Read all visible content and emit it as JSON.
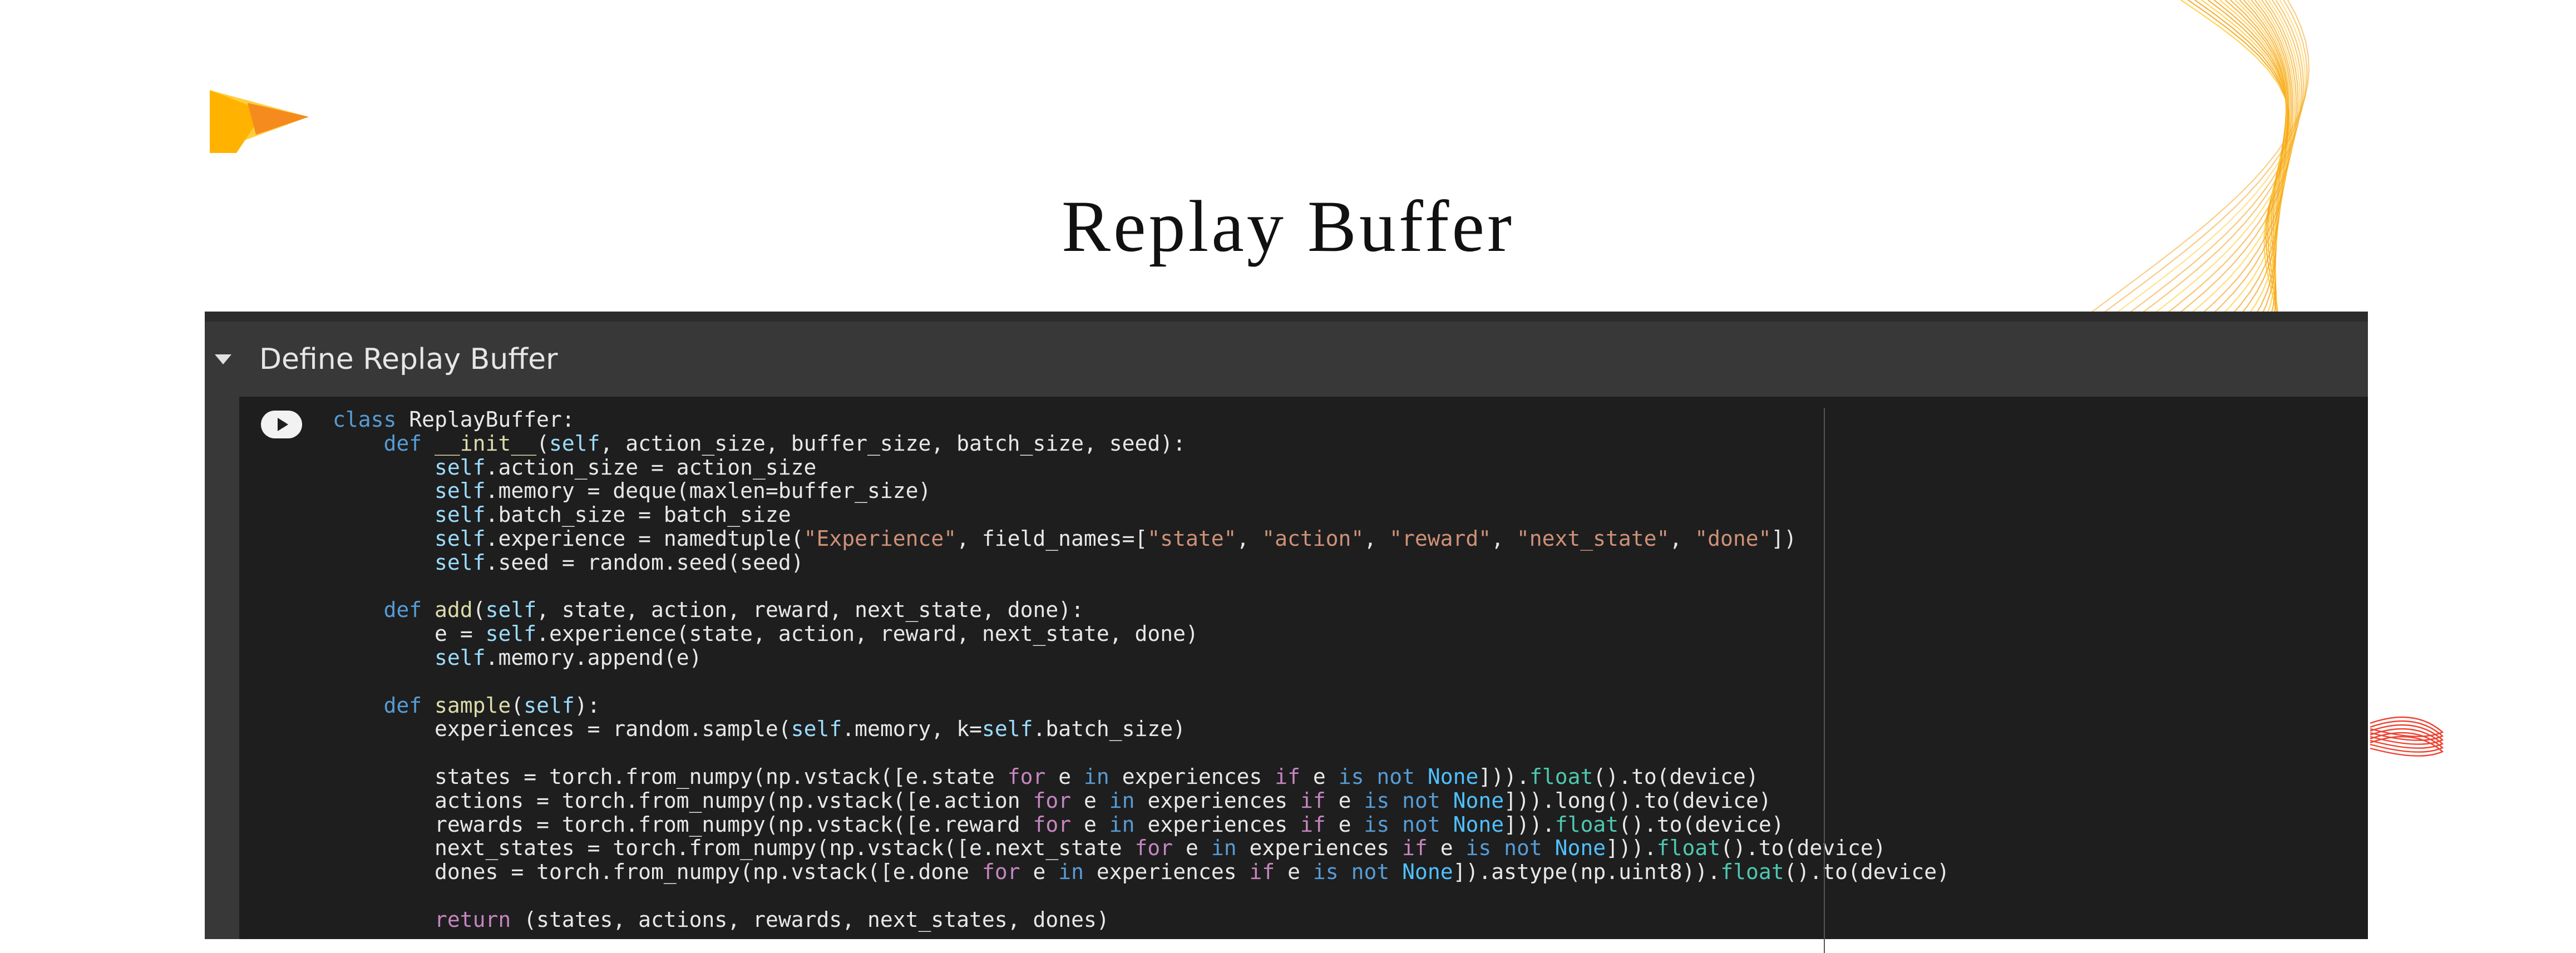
{
  "slide": {
    "title": "Replay Buffer"
  },
  "colors": {
    "accent_orange": "#f5a623",
    "accent_yellow": "#ffcf3a",
    "wave_red": "#ee4433"
  },
  "icons": [
    "play-logo-icon",
    "caret-down-icon",
    "run-cell-icon"
  ],
  "notebook": {
    "section_title": "Define Replay Buffer",
    "code_lines": [
      "class ReplayBuffer:",
      "    def __init__(self, action_size, buffer_size, batch_size, seed):",
      "        self.action_size = action_size",
      "        self.memory = deque(maxlen=buffer_size)",
      "        self.batch_size = batch_size",
      "        self.experience = namedtuple(\"Experience\", field_names=[\"state\", \"action\", \"reward\", \"next_state\", \"done\"])",
      "        self.seed = random.seed(seed)",
      "",
      "    def add(self, state, action, reward, next_state, done):",
      "        e = self.experience(state, action, reward, next_state, done)",
      "        self.memory.append(e)",
      "",
      "    def sample(self):",
      "        experiences = random.sample(self.memory, k=self.batch_size)",
      "",
      "        states = torch.from_numpy(np.vstack([e.state for e in experiences if e is not None])).float().to(device)",
      "        actions = torch.from_numpy(np.vstack([e.action for e in experiences if e is not None])).long().to(device)",
      "        rewards = torch.from_numpy(np.vstack([e.reward for e in experiences if e is not None])).float().to(device)",
      "        next_states = torch.from_numpy(np.vstack([e.next_state for e in experiences if e is not None])).float().to(device)",
      "        dones = torch.from_numpy(np.vstack([e.done for e in experiences if e is not None]).astype(np.uint8)).float().to(device)",
      "",
      "        return (states, actions, rewards, next_states, dones)"
    ]
  }
}
